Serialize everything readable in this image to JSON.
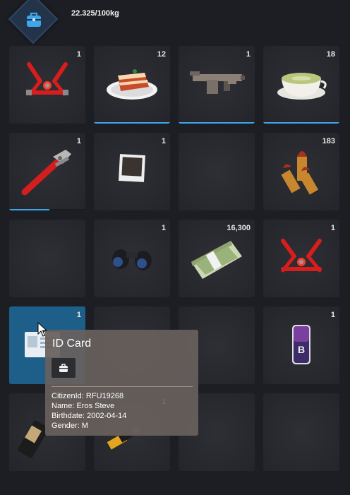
{
  "header": {
    "weight": "22.325/100kg",
    "bag_icon": "backpack-icon",
    "colors": {
      "badge": "#23344a",
      "badge_border": "#2e4560"
    }
  },
  "inventory": {
    "slots": [
      {
        "count": "1",
        "icon": "harness-icon",
        "durability": null
      },
      {
        "count": "12",
        "icon": "tiramisu-icon",
        "durability": 1.0
      },
      {
        "count": "1",
        "icon": "smg-icon",
        "durability": 1.0
      },
      {
        "count": "18",
        "icon": "matcha-latte-icon",
        "durability": 1.0
      },
      {
        "count": "1",
        "icon": "pipe-wrench-icon",
        "durability": 0.53
      },
      {
        "count": "1",
        "icon": "polaroid-photo-icon",
        "durability": null
      },
      {
        "count": "",
        "icon": null,
        "durability": null
      },
      {
        "count": "183",
        "icon": "ammo-icon",
        "durability": null
      },
      {
        "count": "",
        "icon": null,
        "durability": null
      },
      {
        "count": "1",
        "icon": "binoculars-icon",
        "durability": null
      },
      {
        "count": "16,300",
        "icon": "cash-stack-icon",
        "durability": null
      },
      {
        "count": "1",
        "icon": "harness-icon",
        "durability": null
      },
      {
        "count": "1",
        "icon": "id-card-icon",
        "durability": null
      },
      {
        "count": "",
        "icon": null,
        "durability": null
      },
      {
        "count": "",
        "icon": null,
        "durability": null
      },
      {
        "count": "1",
        "icon": "phone-icon",
        "durability": null
      },
      {
        "count": "",
        "icon": "radio-icon",
        "durability": null
      },
      {
        "count": "1",
        "icon": "usb-drive-icon",
        "durability": null
      },
      {
        "count": "",
        "icon": null,
        "durability": null
      },
      {
        "count": "",
        "icon": null,
        "durability": null
      }
    ],
    "colors": {
      "durability": "#3fa5ea",
      "selected_slot": "#1d5f89"
    }
  },
  "tooltip": {
    "title": "ID Card",
    "icon": "backpack-icon",
    "citizen_id": "CitizenId: RFU19268",
    "name": "Name: Eros Steve",
    "birthdate": "Birthdate: 2002-04-14",
    "gender": "Gender: M"
  }
}
